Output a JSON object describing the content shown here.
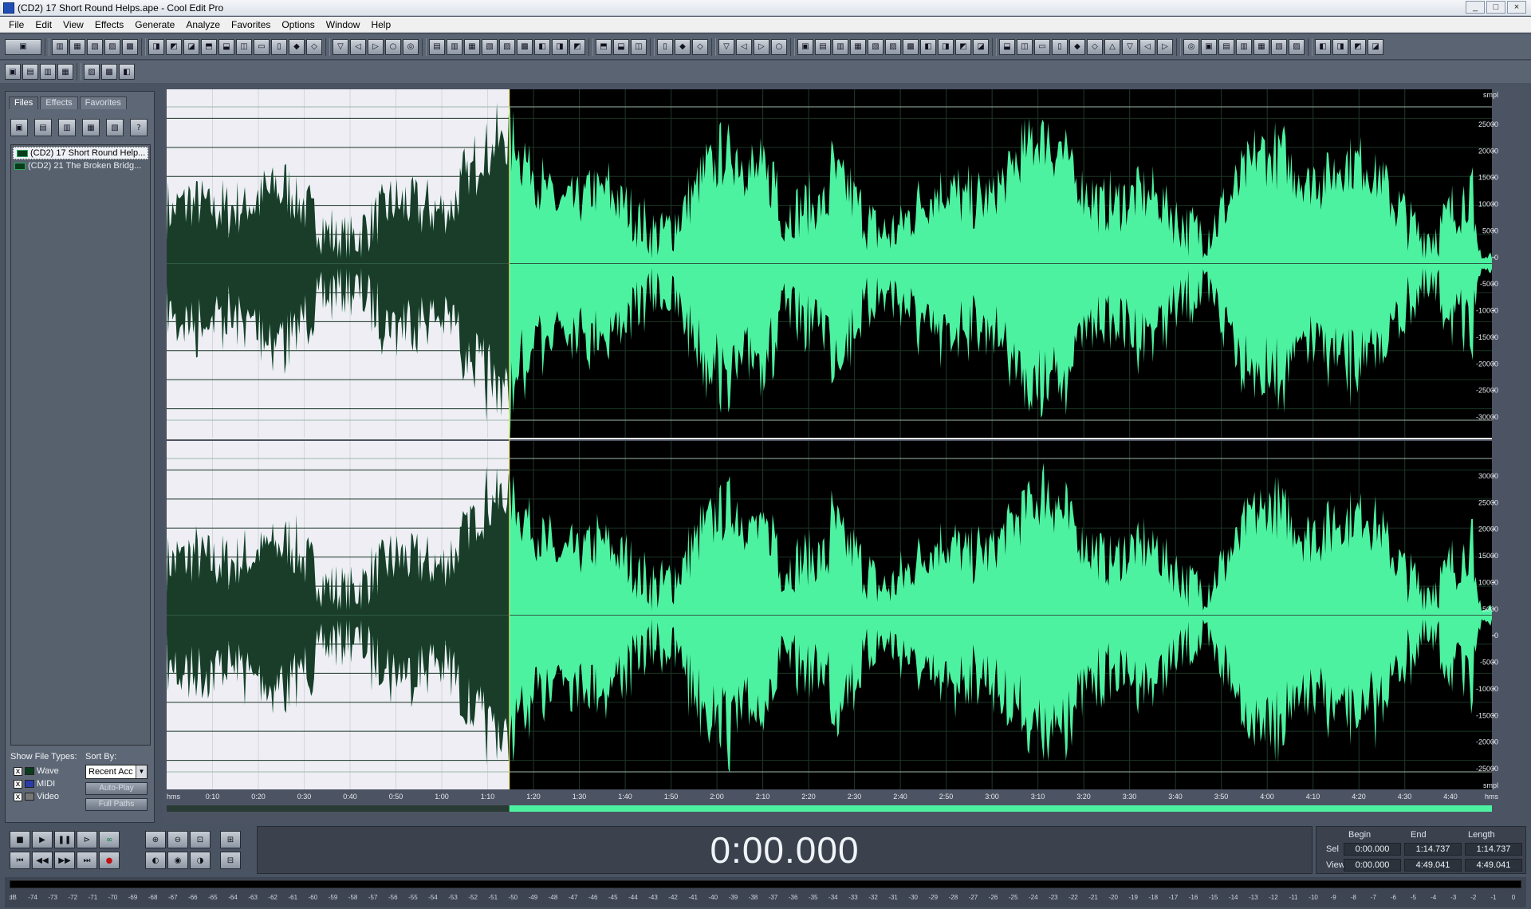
{
  "window": {
    "title": "(CD2) 17 Short Round Helps.ape - Cool Edit Pro",
    "buttons": [
      "_",
      "□",
      "×"
    ]
  },
  "menu": [
    "File",
    "Edit",
    "View",
    "Effects",
    "Generate",
    "Analyze",
    "Favorites",
    "Options",
    "Window",
    "Help"
  ],
  "toolbar1_icons": [
    "multitrack",
    "sep",
    "new-file",
    "open-file",
    "close-file",
    "save-file",
    "save-all",
    "sep",
    "undo",
    "redo",
    "repeat",
    "copy",
    "copy-new",
    "cut",
    "paste",
    "paste-new",
    "mix-paste",
    "trim",
    "sep",
    "envelope",
    "normalize",
    "fade",
    "amplify",
    "stretch",
    "sep",
    "view-a",
    "view-b",
    "view-c",
    "play-sel",
    "zoom-sel",
    "num-1-15",
    "grid",
    "markers",
    "spectral",
    "sep",
    "cue",
    "key",
    "help",
    "sep",
    "spectrum",
    "find",
    "stop-search",
    "sep",
    "fx1",
    "fx2",
    "fx3",
    "fx4",
    "sep",
    "tool1",
    "tool2",
    "tool3",
    "tool4",
    "tool5",
    "tool6",
    "tool7",
    "tool8",
    "tool9",
    "tool10",
    "tool11",
    "sep",
    "a1",
    "a2",
    "a3",
    "a4",
    "a5",
    "a6",
    "a7",
    "a8",
    "a9",
    "a10",
    "sep",
    "b1",
    "b2",
    "b3",
    "b4",
    "b5",
    "b6",
    "b7",
    "sep",
    "c1",
    "c2",
    "c3",
    "c4"
  ],
  "toolbar2_icons": [
    "wave-a",
    "wave-b",
    "wave-c",
    "wave-d",
    "sep",
    "edit-a",
    "edit-b",
    "edit-c"
  ],
  "left_panel": {
    "tabs": [
      "Files",
      "Effects",
      "Favorites"
    ],
    "active_tab": 0,
    "files": [
      "(CD2) 17 Short Round Help...",
      "(CD2) 21 The Broken Bridg..."
    ],
    "selected_file": 0,
    "show_file_types_label": "Show File Types:",
    "sort_by_label": "Sort By:",
    "types": [
      {
        "label": "Wave",
        "checked": "x"
      },
      {
        "label": "MIDI",
        "checked": "x"
      },
      {
        "label": "Video",
        "checked": "x"
      }
    ],
    "sort_value": "Recent Acc",
    "auto_play_label": "Auto-Play",
    "full_paths_label": "Full Paths"
  },
  "waveform": {
    "y_unit": "smpl",
    "y_ticks_top": [
      "25000",
      "20000",
      "15000",
      "10000",
      "5000",
      "0",
      "-5000",
      "-10000",
      "-15000",
      "-20000",
      "-25000",
      "-30000"
    ],
    "y_ticks_bottom": [
      "30000",
      "25000",
      "20000",
      "15000",
      "10000",
      "5000",
      "0",
      "-5000",
      "-10000",
      "-15000",
      "-20000",
      "-25000"
    ],
    "time_unit": "hms",
    "time_ticks": [
      "0:10",
      "0:20",
      "0:30",
      "0:40",
      "0:50",
      "1:00",
      "1:10",
      "1:20",
      "1:30",
      "1:40",
      "1:50",
      "2:00",
      "2:10",
      "2:20",
      "2:30",
      "2:40",
      "2:50",
      "3:00",
      "3:10",
      "3:20",
      "3:30",
      "3:40",
      "3:50",
      "4:00",
      "4:10",
      "4:20",
      "4:30",
      "4:40"
    ],
    "total_seconds": 289.041,
    "selection_end_seconds": 74.737,
    "colors": {
      "selected_bg": "#eeeef4",
      "selected_wave": "#1a3d2a",
      "unselected_bg": "#000000",
      "unselected_wave": "#4cf2a0",
      "grid": "#1f3a2a"
    }
  },
  "transport": {
    "row1": [
      "stop",
      "play",
      "pause",
      "play-to-end",
      "loop"
    ],
    "row2": [
      "go-start",
      "rewind",
      "fast-forward",
      "go-end",
      "record"
    ],
    "zoom_row1": [
      "zoom-in-h",
      "zoom-out-h",
      "zoom-full",
      "zoom-in-v"
    ],
    "zoom_row2": [
      "zoom-sel-left",
      "zoom-sel",
      "zoom-sel-right",
      "zoom-out-v"
    ]
  },
  "time_display": "0:00.000",
  "selection_info": {
    "headers": [
      "Begin",
      "End",
      "Length"
    ],
    "sel_label": "Sel",
    "view_label": "View",
    "sel": [
      "0:00.000",
      "1:14.737",
      "1:14.737"
    ],
    "view": [
      "0:00.000",
      "4:49.041",
      "4:49.041"
    ]
  },
  "level_meter": {
    "ticks": [
      "dB",
      "-74",
      "-73",
      "-72",
      "-71",
      "-70",
      "-69",
      "-68",
      "-67",
      "-66",
      "-65",
      "-64",
      "-63",
      "-62",
      "-61",
      "-60",
      "-59",
      "-58",
      "-57",
      "-56",
      "-55",
      "-54",
      "-53",
      "-52",
      "-51",
      "-50",
      "-49",
      "-48",
      "-47",
      "-46",
      "-45",
      "-44",
      "-43",
      "-42",
      "-41",
      "-40",
      "-39",
      "-38",
      "-37",
      "-36",
      "-35",
      "-34",
      "-33",
      "-32",
      "-31",
      "-30",
      "-29",
      "-28",
      "-27",
      "-26",
      "-25",
      "-24",
      "-23",
      "-22",
      "-21",
      "-20",
      "-19",
      "-18",
      "-17",
      "-16",
      "-15",
      "-14",
      "-13",
      "-12",
      "-11",
      "-10",
      "-9",
      "-8",
      "-7",
      "-6",
      "-5",
      "-4",
      "-3",
      "-2",
      "-1",
      "0"
    ]
  }
}
